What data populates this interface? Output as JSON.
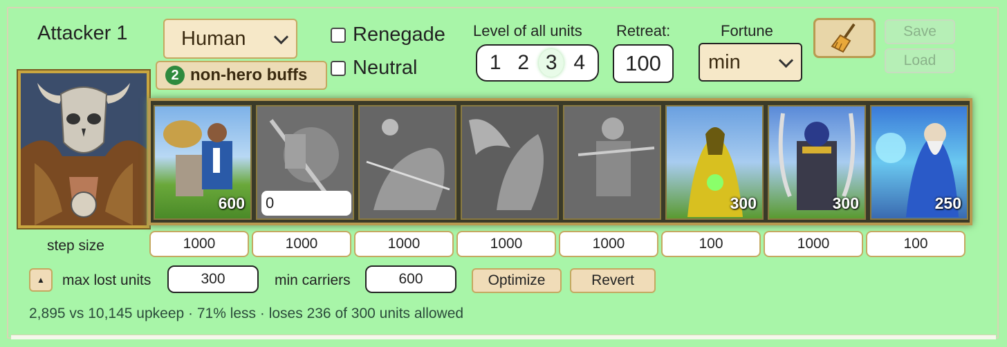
{
  "attacker": {
    "title": "Attacker 1"
  },
  "faction": {
    "selected": "Human"
  },
  "buffs": {
    "count": "2",
    "label": "non-hero buffs"
  },
  "checkboxes": [
    {
      "label": "Renegade",
      "checked": false
    },
    {
      "label": "Neutral",
      "checked": false
    }
  ],
  "levels": {
    "label": "Level of all units",
    "options": [
      "1",
      "2",
      "3",
      "4"
    ],
    "selected": "3"
  },
  "retreat": {
    "label": "Retreat:",
    "value": "100"
  },
  "fortune": {
    "label": "Fortune",
    "selected": "min"
  },
  "actions": {
    "save": "Save",
    "load": "Load",
    "clear_icon": "broom-icon"
  },
  "units": [
    {
      "name": "unit-1",
      "count": "600"
    },
    {
      "name": "unit-2",
      "input_value": "0"
    },
    {
      "name": "unit-3",
      "count": ""
    },
    {
      "name": "unit-4",
      "count": ""
    },
    {
      "name": "unit-5",
      "count": ""
    },
    {
      "name": "unit-6",
      "count": "300"
    },
    {
      "name": "unit-7",
      "count": "300"
    },
    {
      "name": "unit-8",
      "count": "250"
    }
  ],
  "step": {
    "label": "step size",
    "values": [
      "1000",
      "1000",
      "1000",
      "1000",
      "1000",
      "100",
      "1000",
      "100"
    ]
  },
  "optimizer": {
    "toggle_icon": "triangle-up-icon",
    "max_lost_label": "max lost units",
    "max_lost_value": "300",
    "min_carriers_label": "min carriers",
    "min_carriers_value": "600",
    "optimize": "Optimize",
    "revert": "Revert"
  },
  "summary": "2,895 vs 10,145 upkeep · 71% less · loses 236 of 300 units allowed"
}
